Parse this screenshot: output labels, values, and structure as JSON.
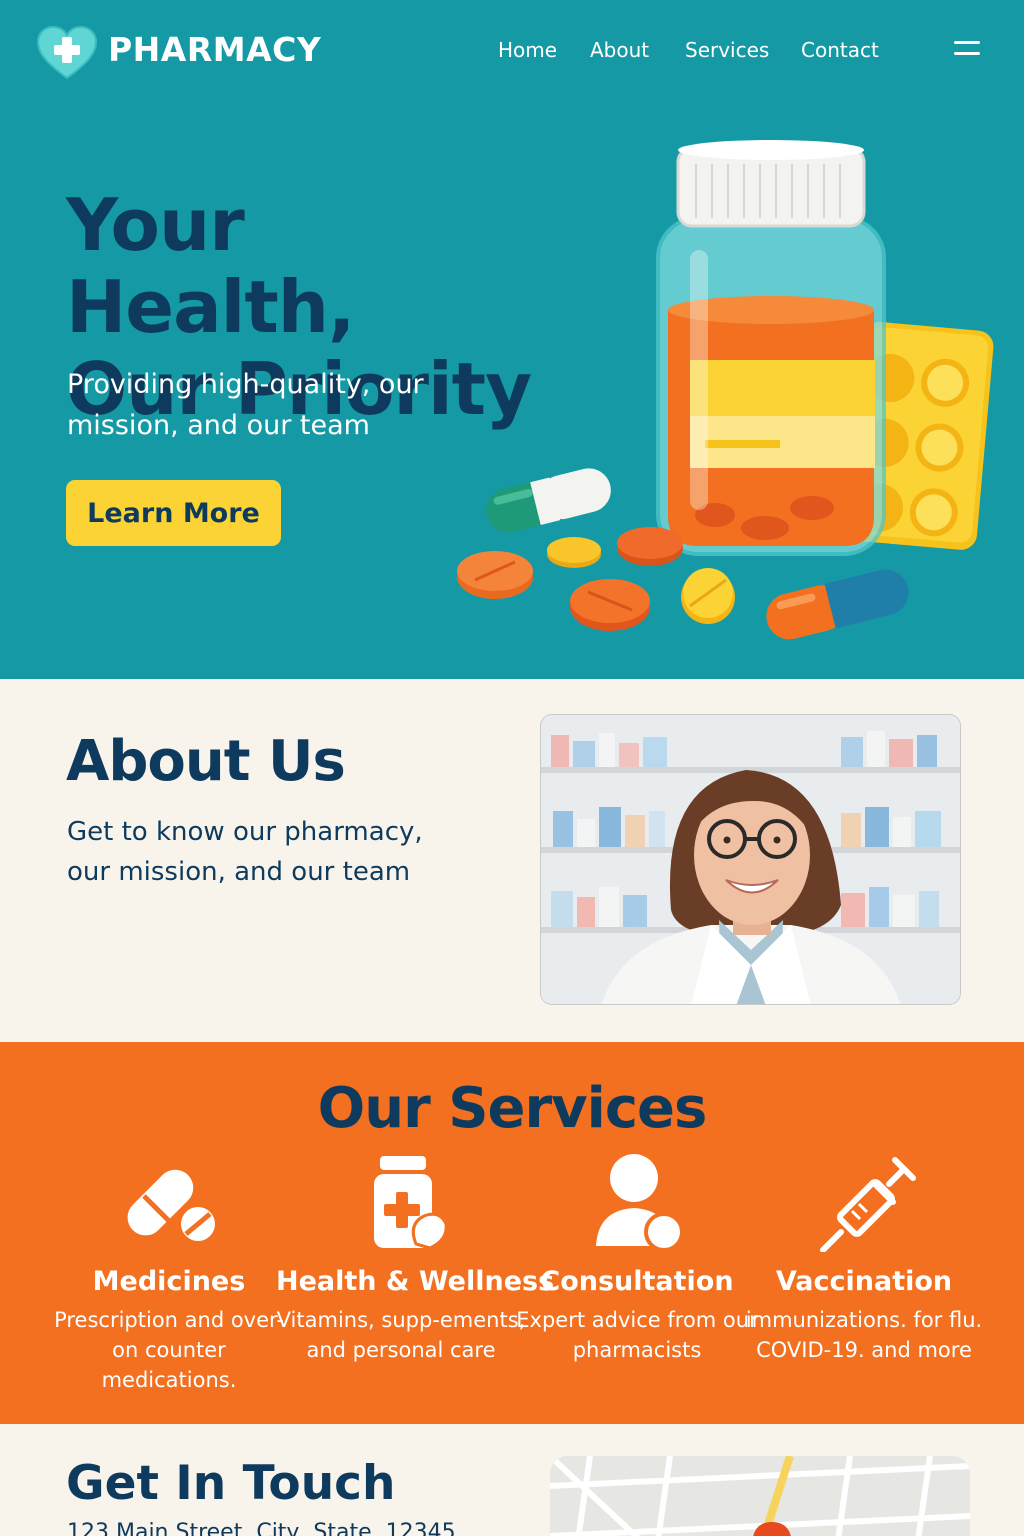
{
  "header": {
    "brand": "PHARMACY",
    "nav": [
      {
        "label": "Home"
      },
      {
        "label": "About"
      },
      {
        "label": "Services"
      },
      {
        "label": "Contact"
      }
    ]
  },
  "hero": {
    "title_line1": "Your Health,",
    "title_line2": "Our Priority",
    "subtitle": "Providing high-quality, our mission, and our team",
    "cta_label": "Learn More"
  },
  "about": {
    "title": "About Us",
    "text": "Get to know our pharmacy, our mission, and our team"
  },
  "services": {
    "title": "Our Services",
    "items": [
      {
        "name": "Medicines",
        "desc": "Prescription and over-on counter medications.",
        "icon": "pill-icon"
      },
      {
        "name": "Health & Wellness",
        "desc": "Vitamins, supp-ements, and personal care",
        "icon": "medicine-bottle-icon"
      },
      {
        "name": "Consultation",
        "desc": "Expert advice from our pharmacists",
        "icon": "person-icon"
      },
      {
        "name": "Vaccination",
        "desc": "immunizations. for flu. COVID-19. and more",
        "icon": "syringe-icon"
      }
    ]
  },
  "contact": {
    "title": "Get In Touch",
    "address": "123 Main Street, City, State, 12345"
  },
  "colors": {
    "hero_bg": "#159aa5",
    "navy": "#0e3b5d",
    "accent_yellow": "#fbd334",
    "services_bg": "#f2701f",
    "page_bg": "#f8f4ec"
  }
}
